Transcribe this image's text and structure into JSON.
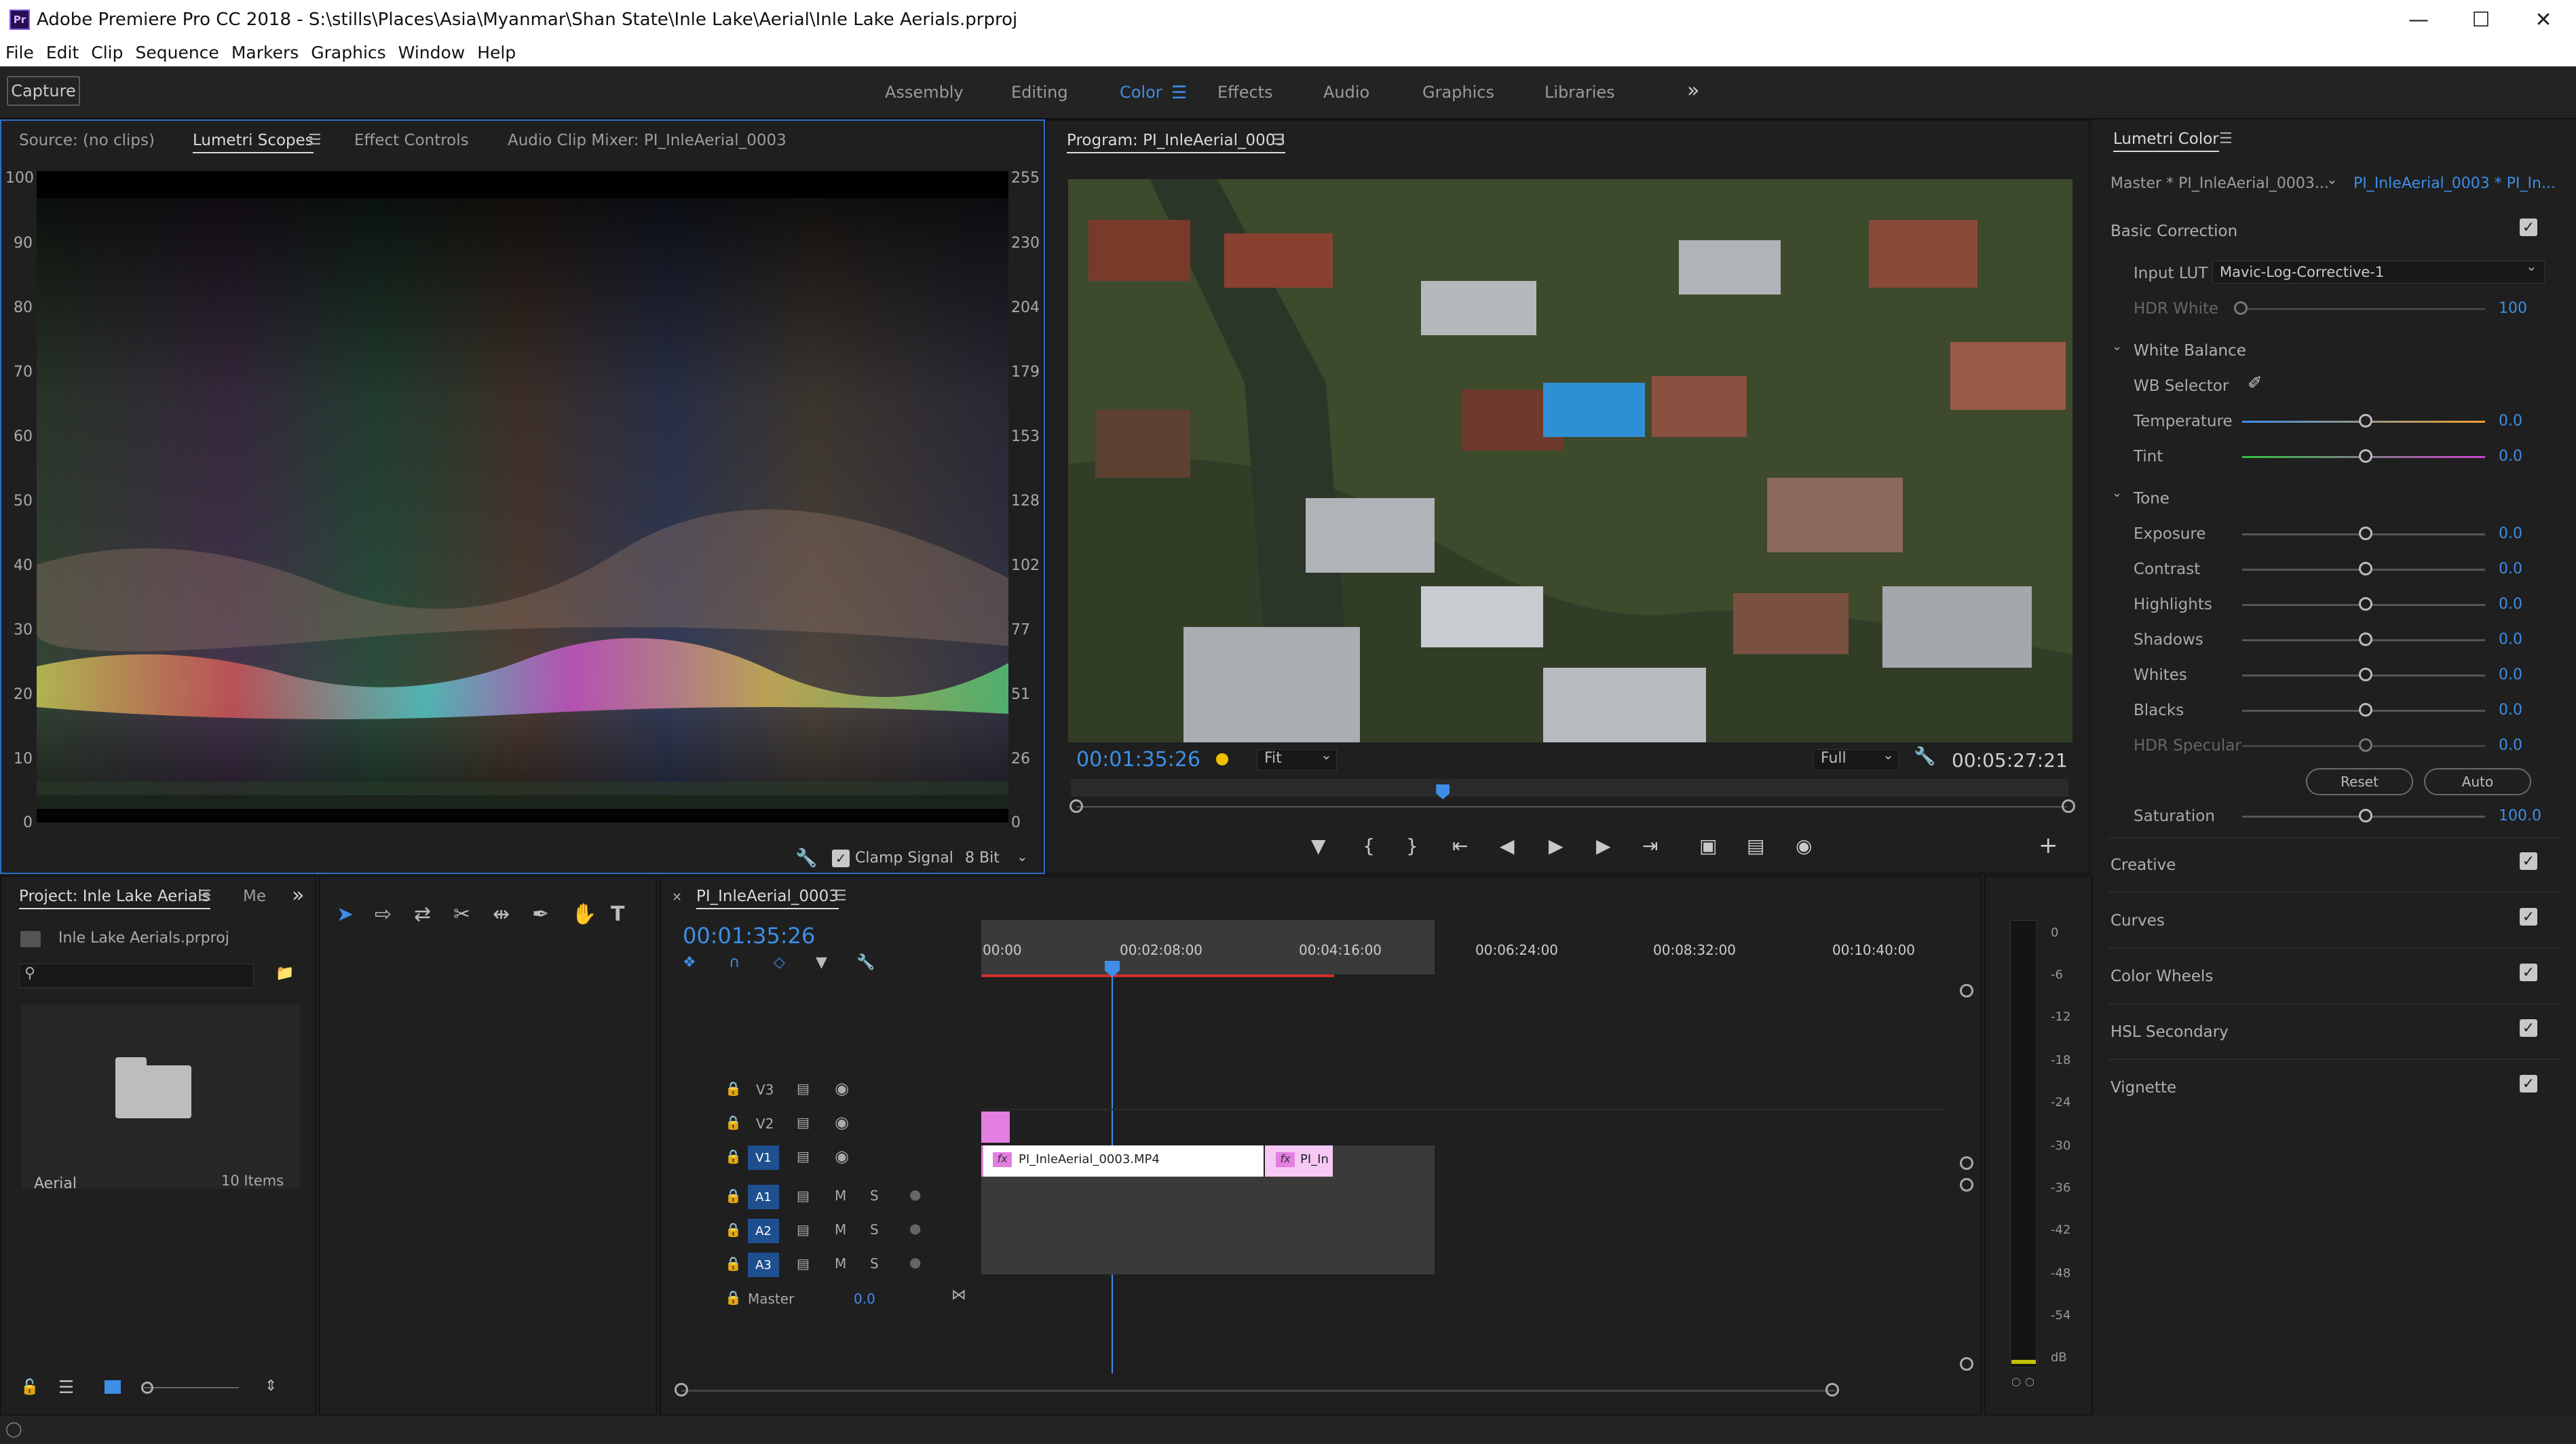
{
  "window": {
    "title": "Adobe Premiere Pro CC 2018 - S:\\stills\\Places\\Asia\\Myanmar\\Shan State\\Inle Lake\\Aerial\\Inle Lake Aerials.prproj",
    "app_icon": "Pr"
  },
  "menu": [
    "File",
    "Edit",
    "Clip",
    "Sequence",
    "Markers",
    "Graphics",
    "Window",
    "Help"
  ],
  "workspaces": {
    "capture": "Capture",
    "items": [
      "Assembly",
      "Editing",
      "Color",
      "Effects",
      "Audio",
      "Graphics",
      "Libraries"
    ],
    "active": "Color"
  },
  "source_panel": {
    "tabs": [
      "Source: (no clips)",
      "Lumetri Scopes",
      "Effect Controls",
      "Audio Clip Mixer: PI_InleAerial_0003"
    ],
    "active_tab": "Lumetri Scopes",
    "left_scale": [
      "100",
      "90",
      "80",
      "70",
      "60",
      "50",
      "40",
      "30",
      "20",
      "10",
      "0"
    ],
    "right_scale": [
      "255",
      "230",
      "204",
      "179",
      "153",
      "128",
      "102",
      "77",
      "51",
      "26",
      "0"
    ],
    "clamp_signal": "Clamp Signal",
    "bit_depth": "8 Bit"
  },
  "program_panel": {
    "title": "Program: PI_InleAerial_0003",
    "timecode_current": "00:01:35:26",
    "timecode_duration": "00:05:27:21",
    "zoom": "Fit",
    "resolution": "Full",
    "playhead_fraction": 0.37
  },
  "lumetri": {
    "title": "Lumetri Color",
    "master_clip": "Master * PI_InleAerial_0003...",
    "sequence_clip": "PI_InleAerial_0003 * PI_In...",
    "basic_correction": "Basic Correction",
    "input_lut_label": "Input LUT",
    "input_lut_value": "Mavic-Log-Corrective-1",
    "hdr_white_label": "HDR White",
    "hdr_white_value": "100",
    "white_balance": "White Balance",
    "wb_selector": "WB Selector",
    "temperature": {
      "label": "Temperature",
      "value": "0.0"
    },
    "tint": {
      "label": "Tint",
      "value": "0.0"
    },
    "tone": "Tone",
    "tone_rows": [
      {
        "label": "Exposure",
        "value": "0.0"
      },
      {
        "label": "Contrast",
        "value": "0.0"
      },
      {
        "label": "Highlights",
        "value": "0.0"
      },
      {
        "label": "Shadows",
        "value": "0.0"
      },
      {
        "label": "Whites",
        "value": "0.0"
      },
      {
        "label": "Blacks",
        "value": "0.0"
      },
      {
        "label": "HDR Specular",
        "value": "0.0"
      }
    ],
    "reset": "Reset",
    "auto": "Auto",
    "saturation": {
      "label": "Saturation",
      "value": "100.0"
    },
    "sections": [
      "Creative",
      "Curves",
      "Color Wheels",
      "HSL Secondary",
      "Vignette"
    ]
  },
  "project_panel": {
    "tab": "Project: Inle Lake Aerials",
    "tab2": "Me",
    "file": "Inle Lake Aerials.prproj",
    "bin_name": "Aerial",
    "bin_count": "10 Items"
  },
  "timeline": {
    "sequence": "PI_InleAerial_0003",
    "timecode": "00:01:35:26",
    "ruler": [
      "00:00",
      "00:02:08:00",
      "00:04:16:00",
      "00:06:24:00",
      "00:08:32:00",
      "00:10:40:00"
    ],
    "video_tracks": [
      "V3",
      "V2",
      "V1"
    ],
    "audio_tracks": [
      "A1",
      "A2",
      "A3"
    ],
    "master_label": "Master",
    "master_value": "0.0",
    "clip1": "PI_InleAerial_0003.MP4",
    "clip2": "PI_In",
    "fx": "fx",
    "mute": "M",
    "solo": "S"
  },
  "meter": {
    "scale": [
      "0",
      "-6",
      "-12",
      "-18",
      "-24",
      "-30",
      "-36",
      "-42",
      "-48",
      "-54",
      "dB"
    ],
    "solo": "S"
  },
  "colors": {
    "accent": "#3e8ee6",
    "panel": "#1f1f1f",
    "clip": "#e27fe0"
  }
}
